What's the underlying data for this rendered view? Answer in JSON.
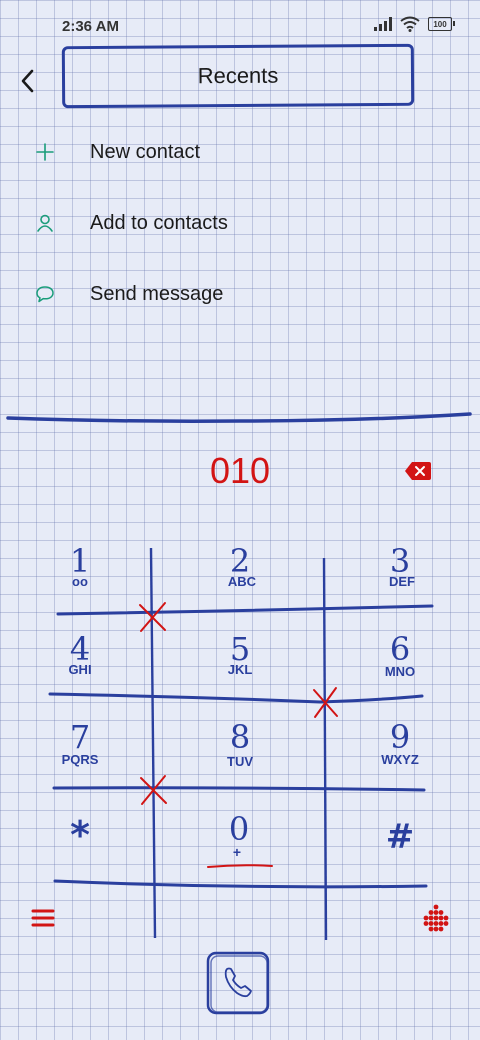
{
  "status_bar": {
    "time": "2:36 AM",
    "battery": "100"
  },
  "header": {
    "title": "Recents"
  },
  "options": [
    {
      "label": "New contact",
      "icon": "plus-icon"
    },
    {
      "label": "Add to contacts",
      "icon": "person-icon"
    },
    {
      "label": "Send message",
      "icon": "message-icon"
    }
  ],
  "dialer": {
    "number": "010"
  },
  "keypad": [
    {
      "digit": "1",
      "sub": "oo"
    },
    {
      "digit": "2",
      "sub": "ABC"
    },
    {
      "digit": "3",
      "sub": "DEF"
    },
    {
      "digit": "4",
      "sub": "GHI"
    },
    {
      "digit": "5",
      "sub": "JKL"
    },
    {
      "digit": "6",
      "sub": "MNO"
    },
    {
      "digit": "7",
      "sub": "PQRS"
    },
    {
      "digit": "8",
      "sub": "TUV"
    },
    {
      "digit": "9",
      "sub": "WXYZ"
    },
    {
      "digit": "*",
      "sub": ""
    },
    {
      "digit": "0",
      "sub": "+"
    },
    {
      "digit": "#",
      "sub": ""
    }
  ],
  "colors": {
    "ink_blue": "#2a3f9e",
    "accent_red": "#d21414",
    "accent_green": "#1a9d7a"
  },
  "icons": {
    "back": "chevron-left-icon",
    "delete": "backspace-icon",
    "menu": "menu-icon",
    "dialpad": "dialpad-icon",
    "call": "phone-icon"
  }
}
